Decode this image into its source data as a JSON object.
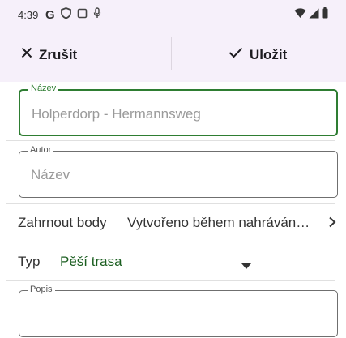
{
  "status_bar": {
    "time": "4:39",
    "left_icons": [
      "google-g-icon",
      "shield-icon",
      "screen-icon",
      "mic-icon"
    ],
    "right_icons": [
      "wifi-icon",
      "signal-icon",
      "battery-icon"
    ]
  },
  "action_bar": {
    "cancel_label": "Zrušit",
    "save_label": "Uložit"
  },
  "form": {
    "name": {
      "legend": "Název",
      "value": "Holperdorp - Hermannsweg"
    },
    "author": {
      "legend": "Autor",
      "placeholder": "Název"
    },
    "include_points": {
      "label": "Zahrnout body",
      "value": "Vytvořeno během nahráván…"
    },
    "type": {
      "label": "Typ",
      "value": "Pěší trasa"
    },
    "description": {
      "legend": "Popis"
    }
  },
  "colors": {
    "accent": "#2e7d32",
    "bar_background": "#f6f0fa"
  }
}
